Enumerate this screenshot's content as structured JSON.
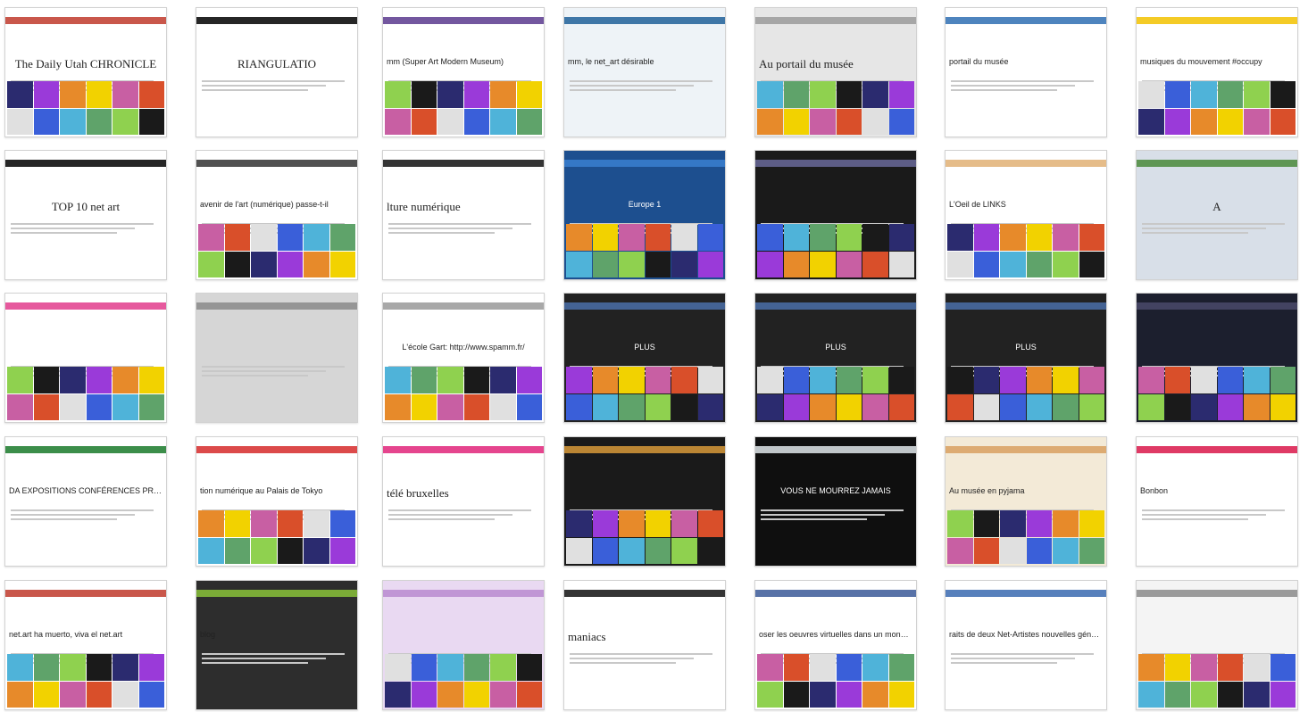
{
  "thumbnails": [
    {
      "caption": "The Daily Utah CHRONICLE",
      "style": "big center",
      "bg": "#ffffff",
      "accent": "#c0392b"
    },
    {
      "caption": "RIANGULATIO",
      "style": "big center",
      "bg": "#ffffff",
      "accent": "#000000"
    },
    {
      "caption": "mm (Super Art Modern Museum)",
      "style": "",
      "bg": "#ffffff",
      "accent": "#5b3a8e"
    },
    {
      "caption": "mm, le net_art désirable",
      "style": "",
      "bg": "#eef3f7",
      "accent": "#1f5f99"
    },
    {
      "caption": "Au portail du musée",
      "style": "big",
      "bg": "#e6e6e6",
      "accent": "#9a9a9a"
    },
    {
      "caption": "portail du musée",
      "style": "",
      "bg": "#ffffff",
      "accent": "#2f6fb3"
    },
    {
      "caption": "musiques du mouvement #occupy",
      "style": "",
      "bg": "#ffffff",
      "accent": "#f2c200"
    },
    {
      "caption": "TOP 10 net art",
      "style": "big center",
      "bg": "#ffffff",
      "accent": "#000000"
    },
    {
      "caption": "avenir de l'art (numérique) passe-t-il",
      "style": "",
      "bg": "#ffffff",
      "accent": "#333333"
    },
    {
      "caption": "lture numérique",
      "style": "big",
      "bg": "#ffffff",
      "accent": "#111111"
    },
    {
      "caption": "Europe 1",
      "style": "center white",
      "bg": "#1d4f8f",
      "accent": "#3a7fd0"
    },
    {
      "caption": "",
      "style": "",
      "bg": "#1a1a1a",
      "accent": "#6a6a9a"
    },
    {
      "caption": "L'Oeil de LINKS",
      "style": "",
      "bg": "#ffffff",
      "accent": "#e0b074"
    },
    {
      "caption": "A",
      "style": "big center",
      "bg": "#d8dfe8",
      "accent": "#4a8a3a"
    },
    {
      "caption": "",
      "style": "",
      "bg": "#ffffff",
      "accent": "#e23c8c"
    },
    {
      "caption": "",
      "style": "",
      "bg": "#d6d6d6",
      "accent": "#8a8a8a"
    },
    {
      "caption": "L'école Gart: http://www.spamm.fr/",
      "style": "center",
      "bg": "#ffffff",
      "accent": "#999999"
    },
    {
      "caption": "PLUS",
      "style": "center white",
      "bg": "#222222",
      "accent": "#4a6fa8"
    },
    {
      "caption": "PLUS",
      "style": "center white",
      "bg": "#222222",
      "accent": "#4a6fa8"
    },
    {
      "caption": "PLUS",
      "style": "center white",
      "bg": "#222222",
      "accent": "#4a6fa8"
    },
    {
      "caption": "",
      "style": "",
      "bg": "#1c1f2e",
      "accent": "#4a4a6a"
    },
    {
      "caption": "DA EXPOSITIONS CONFÉRENCES PROJECTIONS MUSIQUE",
      "style": "",
      "bg": "#ffffff",
      "accent": "#1a7a2a"
    },
    {
      "caption": "tion numérique au Palais de Tokyo",
      "style": "",
      "bg": "#ffffff",
      "accent": "#d62a2a"
    },
    {
      "caption": "télé bruxelles",
      "style": "big",
      "bg": "#ffffff",
      "accent": "#e0247a"
    },
    {
      "caption": "",
      "style": "",
      "bg": "#1a1a1a",
      "accent": "#d89a3a"
    },
    {
      "caption": "VOUS NE MOURREZ JAMAIS",
      "style": "center white",
      "bg": "#0f0f0f",
      "accent": "#dfe6ea"
    },
    {
      "caption": "Au musée en pyjama",
      "style": "",
      "bg": "#f3ead7",
      "accent": "#d8a060"
    },
    {
      "caption": "Bonbon",
      "style": "",
      "bg": "#ffffff",
      "accent": "#d9184a"
    },
    {
      "caption": "net.art ha muerto, viva el net.art",
      "style": "",
      "bg": "#ffffff",
      "accent": "#c0392b"
    },
    {
      "caption": "blog",
      "style": "",
      "bg": "#2d2d2d",
      "accent": "#8ac23a"
    },
    {
      "caption": "",
      "style": "",
      "bg": "#e9d9f2",
      "accent": "#b88ad0"
    },
    {
      "caption": "maniacs",
      "style": "big",
      "bg": "#ffffff",
      "accent": "#111111"
    },
    {
      "caption": "oser les oeuvres virtuelles dans un monde artistique en mutation ?",
      "style": "",
      "bg": "#ffffff",
      "accent": "#3b5998"
    },
    {
      "caption": "raits de deux Net-Artistes nouvelles générations",
      "style": "",
      "bg": "#ffffff",
      "accent": "#3a6ab0"
    },
    {
      "caption": "",
      "style": "",
      "bg": "#f4f4f4",
      "accent": "#8a8a8a"
    }
  ]
}
